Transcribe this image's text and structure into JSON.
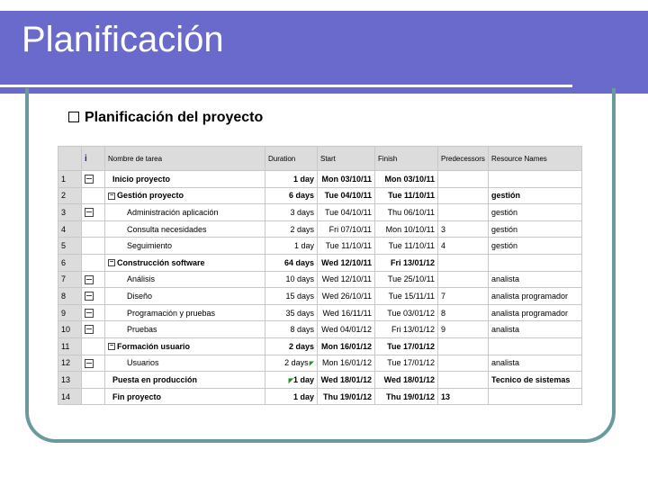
{
  "slide": {
    "title": "Planificación",
    "bullet": "Planificación del proyecto"
  },
  "table": {
    "headers": {
      "info": "i",
      "name": "Nombre de tarea",
      "duration": "Duration",
      "start": "Start",
      "finish": "Finish",
      "predecessors": "Predecessors",
      "resources": "Resource Names"
    },
    "rows": [
      {
        "id": "1",
        "name": "Inicio proyecto",
        "duration": "1 day",
        "start": "Mon 03/10/11",
        "finish": "Mon 03/10/11",
        "pred": "",
        "res": ""
      },
      {
        "id": "2",
        "name": "Gestión proyecto",
        "duration": "6 days",
        "start": "Tue 04/10/11",
        "finish": "Tue 11/10/11",
        "pred": "",
        "res": "gestión"
      },
      {
        "id": "3",
        "name": "Administración aplicación",
        "duration": "3 days",
        "start": "Tue 04/10/11",
        "finish": "Thu 06/10/11",
        "pred": "",
        "res": "gestión"
      },
      {
        "id": "4",
        "name": "Consulta necesidades",
        "duration": "2 days",
        "start": "Fri 07/10/11",
        "finish": "Mon 10/10/11",
        "pred": "3",
        "res": "gestión"
      },
      {
        "id": "5",
        "name": "Seguimiento",
        "duration": "1 day",
        "start": "Tue 11/10/11",
        "finish": "Tue 11/10/11",
        "pred": "4",
        "res": "gestión"
      },
      {
        "id": "6",
        "name": "Construcción software",
        "duration": "64 days",
        "start": "Wed 12/10/11",
        "finish": "Fri 13/01/12",
        "pred": "",
        "res": ""
      },
      {
        "id": "7",
        "name": "Análisis",
        "duration": "10 days",
        "start": "Wed 12/10/11",
        "finish": "Tue 25/10/11",
        "pred": "",
        "res": "analista"
      },
      {
        "id": "8",
        "name": "Diseño",
        "duration": "15 days",
        "start": "Wed 26/10/11",
        "finish": "Tue 15/11/11",
        "pred": "7",
        "res": "analista programador"
      },
      {
        "id": "9",
        "name": "Programación y pruebas",
        "duration": "35 days",
        "start": "Wed 16/11/11",
        "finish": "Tue 03/01/12",
        "pred": "8",
        "res": "analista programador"
      },
      {
        "id": "10",
        "name": "Pruebas",
        "duration": "8 days",
        "start": "Wed 04/01/12",
        "finish": "Fri 13/01/12",
        "pred": "9",
        "res": "analista"
      },
      {
        "id": "11",
        "name": "Formación usuario",
        "duration": "2 days",
        "start": "Mon 16/01/12",
        "finish": "Tue 17/01/12",
        "pred": "",
        "res": ""
      },
      {
        "id": "12",
        "name": "Usuarios",
        "duration": "2 days",
        "start": "Mon 16/01/12",
        "finish": "Tue 17/01/12",
        "pred": "",
        "res": "analista"
      },
      {
        "id": "13",
        "name": "Puesta en producción",
        "duration": "1 day",
        "start": "Wed 18/01/12",
        "finish": "Wed 18/01/12",
        "pred": "",
        "res": "Tecnico de sistemas"
      },
      {
        "id": "14",
        "name": "Fin proyecto",
        "duration": "1 day",
        "start": "Thu 19/01/12",
        "finish": "Thu 19/01/12",
        "pred": "13",
        "res": ""
      }
    ]
  },
  "colors": {
    "title_band": "#6a6acd",
    "frame": "#6b9a9c"
  }
}
